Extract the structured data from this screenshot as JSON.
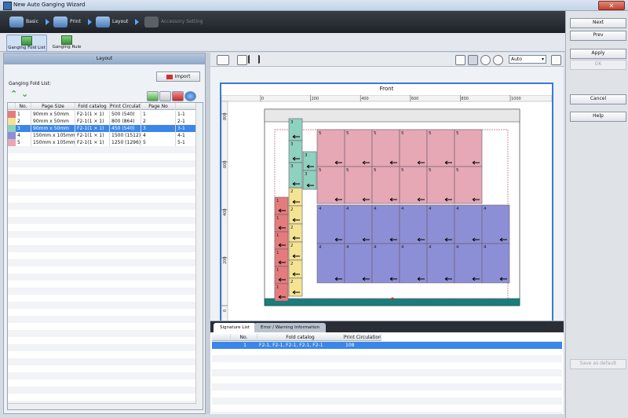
{
  "window": {
    "title": "New Auto Ganging Wizard",
    "close_glyph": "✕"
  },
  "steps": [
    {
      "label": "Basic",
      "enabled": true
    },
    {
      "label": "Print",
      "enabled": true
    },
    {
      "label": "Layout",
      "enabled": true
    },
    {
      "label": "Accessory Setting",
      "enabled": false
    }
  ],
  "subtabs": [
    {
      "label": "Ganging Fold List",
      "selected": true
    },
    {
      "label": "Ganging Rule",
      "selected": false
    }
  ],
  "left": {
    "header": "Layout",
    "import_label": "Import",
    "list_label": "Ganging Fold List:",
    "up_glyph": "⌃",
    "down_glyph": "⌄",
    "columns": [
      "No.",
      "Page Size",
      "Fold catalog",
      "Print Circulation",
      "Page No",
      ""
    ],
    "rows": [
      {
        "no": "1",
        "size": "90mm x 50mm",
        "fold": "F2-1(1 × 1)",
        "circ": "500 (540)",
        "page": "1",
        "sig": "1-1",
        "color": "#e57c7c",
        "selected": false
      },
      {
        "no": "2",
        "size": "90mm x 50mm",
        "fold": "F2-1(1 × 1)",
        "circ": "800 (864)",
        "page": "2",
        "sig": "2-1",
        "color": "#f4e391",
        "selected": false
      },
      {
        "no": "3",
        "size": "90mm x 50mm",
        "fold": "F2-1(1 × 1)",
        "circ": "450 (540)",
        "page": "3",
        "sig": "3-1",
        "color": "#8fd1bf",
        "selected": true
      },
      {
        "no": "4",
        "size": "150mm x 105mm",
        "fold": "F2-1(1 × 1)",
        "circ": "1500 (1512)",
        "page": "4",
        "sig": "4-1",
        "color": "#8d8fd6",
        "selected": false
      },
      {
        "no": "5",
        "size": "150mm x 105mm",
        "fold": "F2-1(1 × 1)",
        "circ": "1250 (1296)",
        "page": "5",
        "sig": "5-1",
        "color": "#e5a8b4",
        "selected": false
      }
    ]
  },
  "canvas": {
    "title": "Front",
    "zoom": "Auto",
    "ruler_x": [
      "0",
      "200",
      "400",
      "600",
      "800",
      "1000"
    ],
    "ruler_y": [
      "800",
      "600",
      "400",
      "200",
      "0"
    ]
  },
  "bottom": {
    "tabs": [
      "Signature List",
      "Error / Warning Information"
    ],
    "columns": [
      "No.",
      "Fold catalog",
      "Print Circulation"
    ],
    "rows": [
      {
        "no": "1",
        "fold": "F2-1, F2-1, F2-1, F2-1, F2-1",
        "circ": "108"
      }
    ]
  },
  "buttons": {
    "next": "Next",
    "prev": "Prev",
    "apply": "Apply",
    "ok": "OK",
    "cancel": "Cancel",
    "help": "Help",
    "save_default": "Save as default"
  }
}
